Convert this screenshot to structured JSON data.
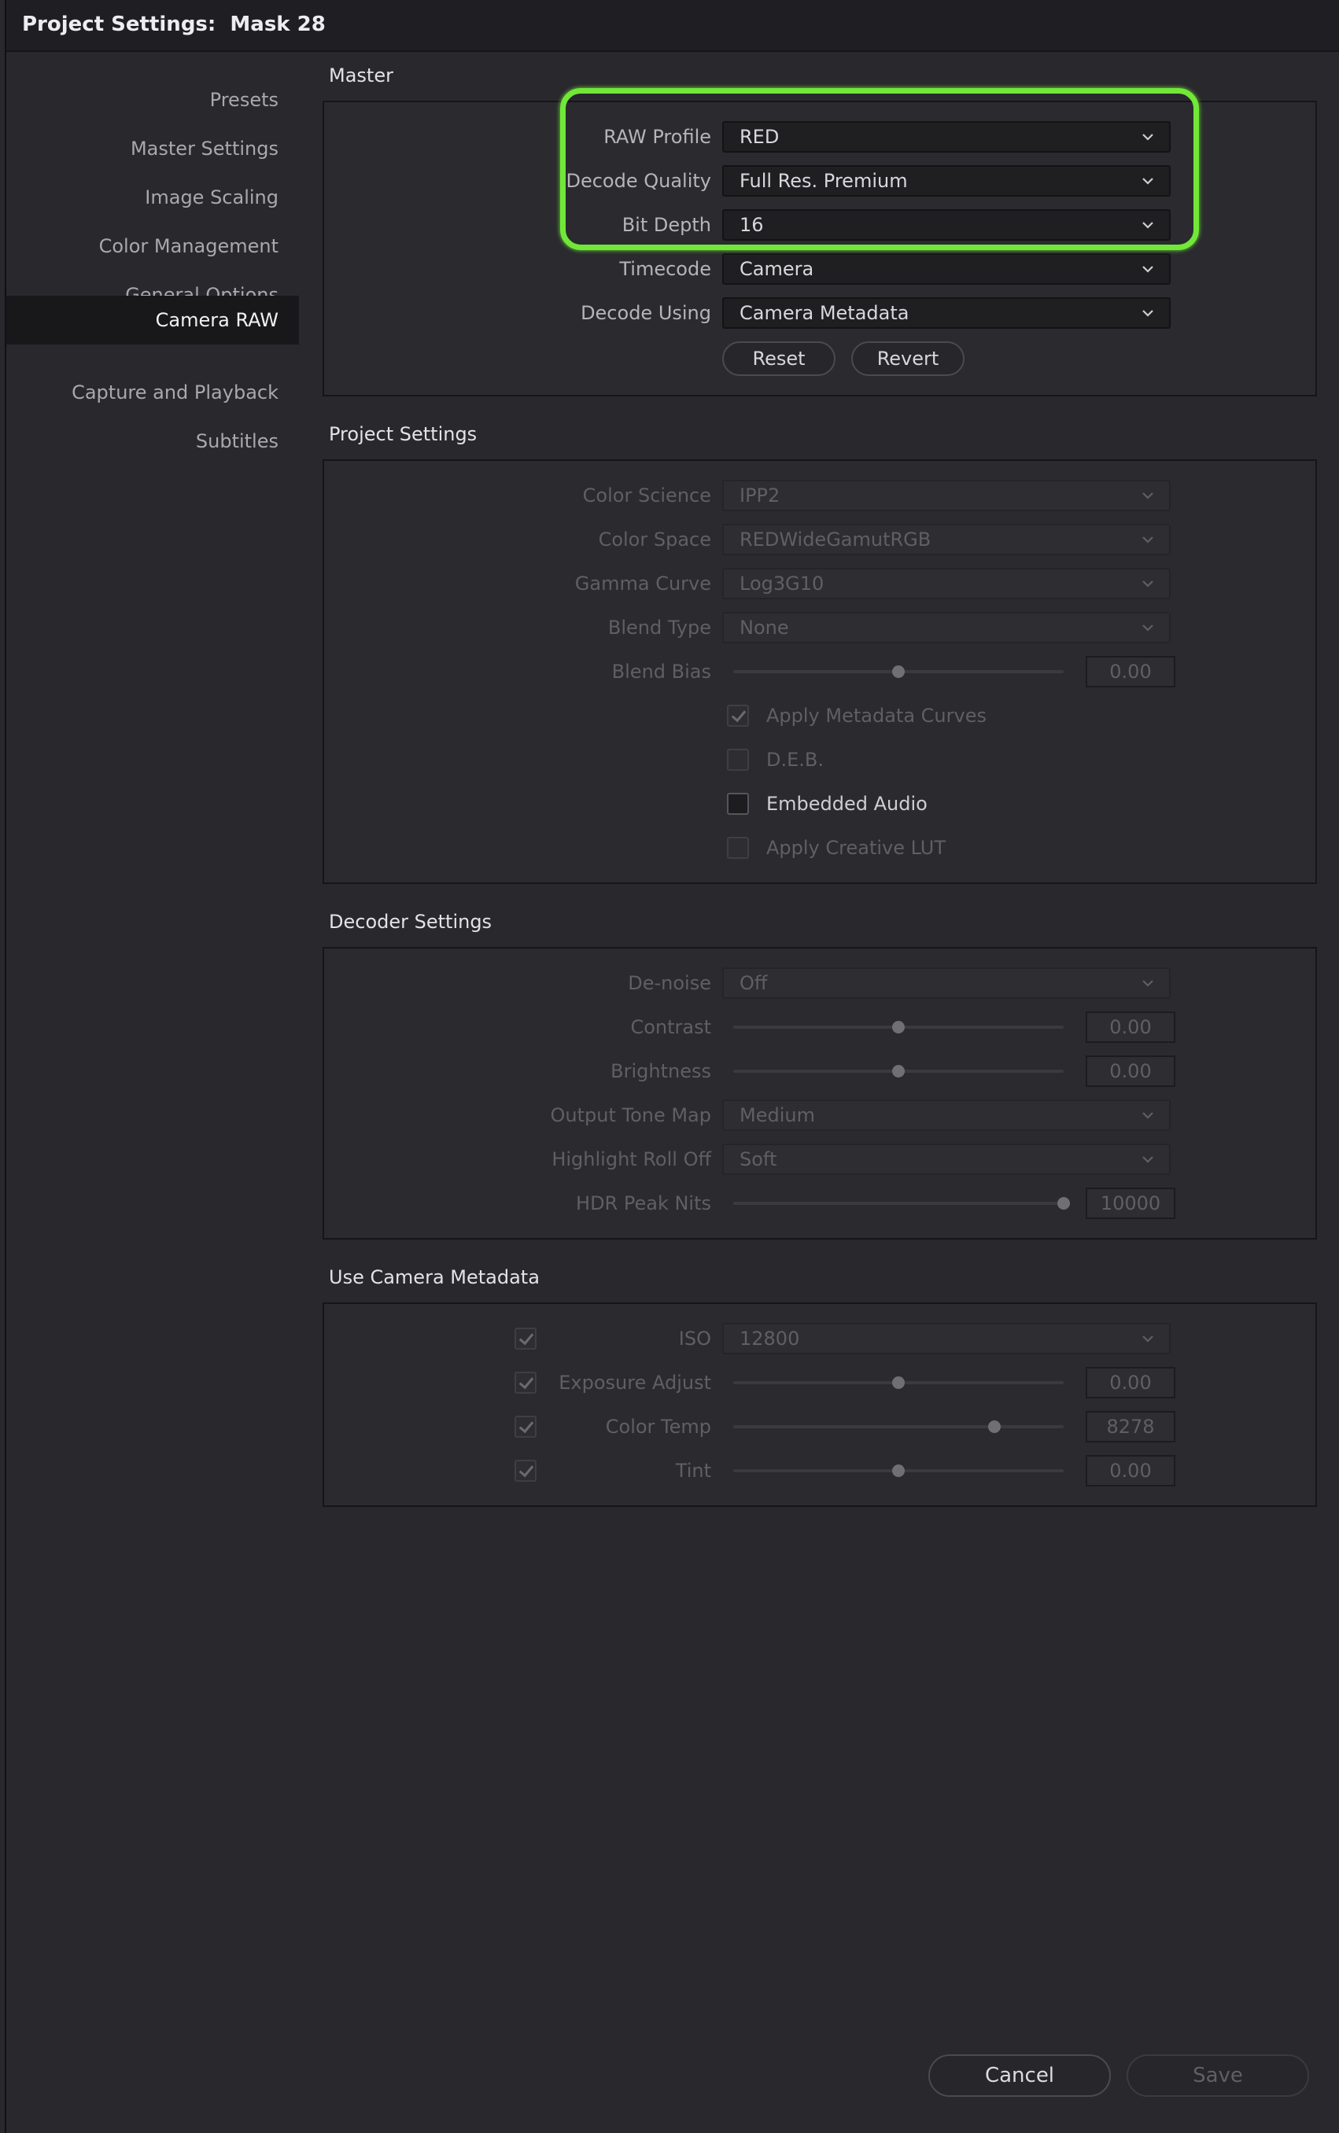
{
  "window": {
    "title": "Project Settings:  Mask 28"
  },
  "sidebar": {
    "items": [
      {
        "label": "Presets",
        "active": false
      },
      {
        "label": "Master Settings",
        "active": false
      },
      {
        "label": "Image Scaling",
        "active": false
      },
      {
        "label": "Color Management",
        "active": false
      },
      {
        "label": "General Options",
        "active": false
      },
      {
        "label": "Camera RAW",
        "active": true
      },
      {
        "label": "Capture and Playback",
        "active": false
      },
      {
        "label": "Subtitles",
        "active": false
      }
    ]
  },
  "master": {
    "title": "Master",
    "raw_profile": {
      "label": "RAW Profile",
      "value": "RED"
    },
    "decode_quality": {
      "label": "Decode Quality",
      "value": "Full Res. Premium"
    },
    "bit_depth": {
      "label": "Bit Depth",
      "value": "16"
    },
    "timecode": {
      "label": "Timecode",
      "value": "Camera"
    },
    "decode_using": {
      "label": "Decode Using",
      "value": "Camera Metadata"
    },
    "reset_label": "Reset",
    "revert_label": "Revert"
  },
  "project_settings": {
    "title": "Project Settings",
    "color_science": {
      "label": "Color Science",
      "value": "IPP2"
    },
    "color_space": {
      "label": "Color Space",
      "value": "REDWideGamutRGB"
    },
    "gamma_curve": {
      "label": "Gamma Curve",
      "value": "Log3G10"
    },
    "blend_type": {
      "label": "Blend Type",
      "value": "None"
    },
    "blend_bias": {
      "label": "Blend Bias",
      "value": "0.00",
      "level": 0.5
    },
    "apply_metadata_curves": {
      "label": "Apply Metadata Curves",
      "checked": true
    },
    "deb": {
      "label": "D.E.B.",
      "checked": false
    },
    "embedded_audio": {
      "label": "Embedded Audio",
      "checked": false
    },
    "apply_creative_lut": {
      "label": "Apply Creative LUT",
      "checked": false
    }
  },
  "decoder_settings": {
    "title": "Decoder Settings",
    "denoise": {
      "label": "De-noise",
      "value": "Off"
    },
    "contrast": {
      "label": "Contrast",
      "value": "0.00",
      "level": 0.5
    },
    "brightness": {
      "label": "Brightness",
      "value": "0.00",
      "level": 0.5
    },
    "output_tone_map": {
      "label": "Output Tone Map",
      "value": "Medium"
    },
    "highlight_roll_off": {
      "label": "Highlight Roll Off",
      "value": "Soft"
    },
    "hdr_peak_nits": {
      "label": "HDR Peak Nits",
      "value": "10000",
      "level": 1.0
    }
  },
  "camera_metadata": {
    "title": "Use Camera Metadata",
    "iso": {
      "label": "ISO",
      "value": "12800",
      "checked": true
    },
    "exposure_adjust": {
      "label": "Exposure Adjust",
      "value": "0.00",
      "checked": true,
      "level": 0.5
    },
    "color_temp": {
      "label": "Color Temp",
      "value": "8278",
      "checked": true,
      "level": 0.79
    },
    "tint": {
      "label": "Tint",
      "value": "0.00",
      "checked": true,
      "level": 0.5
    }
  },
  "footer": {
    "cancel_label": "Cancel",
    "save_label": "Save"
  },
  "colors": {
    "accent_highlight": "#71e838",
    "bg": "#28282d"
  }
}
